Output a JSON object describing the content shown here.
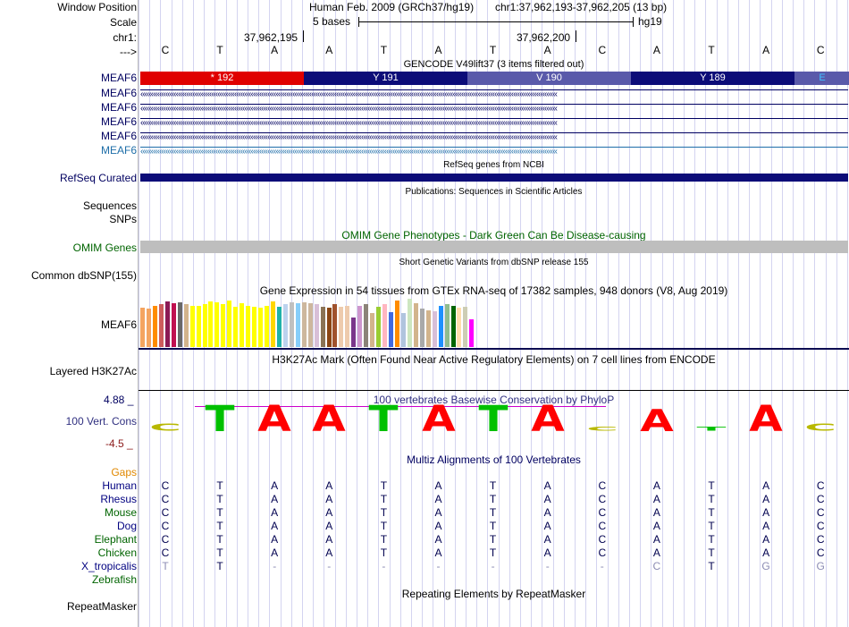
{
  "header": {
    "window_position_label": "Window Position",
    "assembly_text": "Human Feb. 2009 (GRCh37/hg19)",
    "position_text": "chr1:37,962,193-37,962,205 (13 bp)",
    "scale_label": "Scale",
    "scale_text": "5 bases",
    "scale_db": "hg19",
    "chr_label": "chr1:",
    "coord_1": "37,962,195",
    "coord_2": "37,962,200",
    "arrow_label": "--->"
  },
  "bases": [
    "C",
    "T",
    "A",
    "A",
    "T",
    "A",
    "T",
    "A",
    "C",
    "A",
    "T",
    "A",
    "C"
  ],
  "gencode": {
    "title": "GENCODE V49lift37 (3 items filtered out)",
    "segments": [
      {
        "label": "* 192",
        "color": "#e00000"
      },
      {
        "label": "Y 191",
        "color": "#0c0c78"
      },
      {
        "label": "V 190",
        "color": "#5a5aaa"
      },
      {
        "label": "Y 189",
        "color": "#0c0c78"
      },
      {
        "label": "E",
        "color": "#5a5aaa"
      }
    ],
    "tracks": [
      "MEAF6",
      "MEAF6",
      "MEAF6",
      "MEAF6",
      "MEAF6",
      "MEAF6"
    ],
    "track_colors": [
      "#000060",
      "#000060",
      "#000060",
      "#000060",
      "#000060",
      "#1e6ea8"
    ]
  },
  "refseq": {
    "title": "RefSeq genes from NCBI",
    "label": "RefSeq Curated"
  },
  "publications": {
    "title": "Publications: Sequences in Scientific Articles",
    "label": "Sequences"
  },
  "snps": {
    "label": "SNPs"
  },
  "omim": {
    "title": "OMIM Gene Phenotypes - Dark Green Can Be Disease-causing",
    "label": "OMIM Genes"
  },
  "dbsnp": {
    "title": "Short Genetic Variants from dbSNP release 155",
    "label": "Common dbSNP(155)"
  },
  "gtex": {
    "title": "Gene Expression in 54 tissues from GTEx RNA-seq of 17382 samples, 948 donors (V8, Aug 2019)",
    "label": "MEAF6",
    "bars": [
      {
        "v": 0.82,
        "c": "#f4a460"
      },
      {
        "v": 0.8,
        "c": "#f4a460"
      },
      {
        "v": 0.85,
        "c": "#ff8c00"
      },
      {
        "v": 0.88,
        "c": "#cd5c5c"
      },
      {
        "v": 0.95,
        "c": "#8b1a55"
      },
      {
        "v": 0.9,
        "c": "#c01050"
      },
      {
        "v": 0.92,
        "c": "#696969"
      },
      {
        "v": 0.88,
        "c": "#d2b48c"
      },
      {
        "v": 0.86,
        "c": "#ffff00"
      },
      {
        "v": 0.86,
        "c": "#ffff00"
      },
      {
        "v": 0.88,
        "c": "#ffff00"
      },
      {
        "v": 0.95,
        "c": "#ffff00"
      },
      {
        "v": 0.92,
        "c": "#ffff00"
      },
      {
        "v": 0.88,
        "c": "#ffff00"
      },
      {
        "v": 0.96,
        "c": "#ffff00"
      },
      {
        "v": 0.84,
        "c": "#ffff00"
      },
      {
        "v": 0.9,
        "c": "#ffff00"
      },
      {
        "v": 0.86,
        "c": "#ffff00"
      },
      {
        "v": 0.84,
        "c": "#ffff00"
      },
      {
        "v": 0.82,
        "c": "#ffff00"
      },
      {
        "v": 0.86,
        "c": "#ffff00"
      },
      {
        "v": 0.94,
        "c": "#ffd700"
      },
      {
        "v": 0.84,
        "c": "#20b2aa"
      },
      {
        "v": 0.88,
        "c": "#bcd2ee"
      },
      {
        "v": 0.92,
        "c": "#c0c0c0"
      },
      {
        "v": 0.9,
        "c": "#87cefa"
      },
      {
        "v": 0.93,
        "c": "#cdb79e"
      },
      {
        "v": 0.9,
        "c": "#cdb79e"
      },
      {
        "v": 0.88,
        "c": "#d8bfd8"
      },
      {
        "v": 0.84,
        "c": "#8b7355"
      },
      {
        "v": 0.82,
        "c": "#8b4513"
      },
      {
        "v": 0.88,
        "c": "#a0522d"
      },
      {
        "v": 0.84,
        "c": "#eecbad"
      },
      {
        "v": 0.86,
        "c": "#eecbad"
      },
      {
        "v": 0.62,
        "c": "#7a378b"
      },
      {
        "v": 0.86,
        "c": "#cd96cd"
      },
      {
        "v": 0.88,
        "c": "#8b8378"
      },
      {
        "v": 0.7,
        "c": "#d2b48c"
      },
      {
        "v": 0.84,
        "c": "#9acd32"
      },
      {
        "v": 0.88,
        "c": "#ffb6c1"
      },
      {
        "v": 0.72,
        "c": "#4169e1"
      },
      {
        "v": 0.96,
        "c": "#ff8c00"
      },
      {
        "v": 0.7,
        "c": "#b0c4de"
      },
      {
        "v": 1.0,
        "c": "#cde6c0"
      },
      {
        "v": 0.9,
        "c": "#d2b48c"
      },
      {
        "v": 0.8,
        "c": "#a9a9a9"
      },
      {
        "v": 0.76,
        "c": "#d2b48c"
      },
      {
        "v": 0.74,
        "c": "#d8bfd8"
      },
      {
        "v": 0.86,
        "c": "#1e90ff"
      },
      {
        "v": 0.88,
        "c": "#8fbc8f"
      },
      {
        "v": 0.86,
        "c": "#006400"
      },
      {
        "v": 0.82,
        "c": "#ffdead"
      },
      {
        "v": 0.84,
        "c": "#cdcdb4"
      },
      {
        "v": 0.58,
        "c": "#ff00ff"
      }
    ]
  },
  "h3k27ac": {
    "title": "H3K27Ac Mark (Often Found Near Active Regulatory Elements) on 7 cell lines from ENCODE",
    "label": "Layered H3K27Ac"
  },
  "phylop": {
    "title": "100 vertebrates Basewise Conservation by PhyloP",
    "label": "100 Vert. Cons",
    "max_label": "4.88 _",
    "min_label": "-4.5 _",
    "heights": [
      0.25,
      0.95,
      0.95,
      0.95,
      0.95,
      0.95,
      0.95,
      0.95,
      0.15,
      0.8,
      0.15,
      0.95,
      0.25
    ],
    "colors": {
      "A": "#ff0000",
      "T": "#00c000",
      "C": "#b8b800",
      "G": "#e8a000"
    }
  },
  "multiz": {
    "title": "Multiz Alignments of 100 Vertebrates",
    "gaps_label": "Gaps",
    "species": [
      {
        "name": "Human",
        "color": "#000080",
        "seq": [
          "C",
          "T",
          "A",
          "A",
          "T",
          "A",
          "T",
          "A",
          "C",
          "A",
          "T",
          "A",
          "C"
        ]
      },
      {
        "name": "Rhesus",
        "color": "#000080",
        "seq": [
          "C",
          "T",
          "A",
          "A",
          "T",
          "A",
          "T",
          "A",
          "C",
          "A",
          "T",
          "A",
          "C"
        ]
      },
      {
        "name": "Mouse",
        "color": "#006400",
        "seq": [
          "C",
          "T",
          "A",
          "A",
          "T",
          "A",
          "T",
          "A",
          "C",
          "A",
          "T",
          "A",
          "C"
        ]
      },
      {
        "name": "Dog",
        "color": "#000080",
        "seq": [
          "C",
          "T",
          "A",
          "A",
          "T",
          "A",
          "T",
          "A",
          "C",
          "A",
          "T",
          "A",
          "C"
        ]
      },
      {
        "name": "Elephant",
        "color": "#006400",
        "seq": [
          "C",
          "T",
          "A",
          "A",
          "T",
          "A",
          "T",
          "A",
          "C",
          "A",
          "T",
          "A",
          "C"
        ]
      },
      {
        "name": "Chicken",
        "color": "#006400",
        "seq": [
          "C",
          "T",
          "A",
          "A",
          "T",
          "A",
          "T",
          "A",
          "C",
          "A",
          "T",
          "A",
          "C"
        ]
      },
      {
        "name": "X_tropicalis",
        "color": "#000080",
        "seq": [
          "T",
          "T",
          "-",
          "-",
          "-",
          "-",
          "-",
          "-",
          "-",
          "C",
          "T",
          "G",
          "G"
        ]
      },
      {
        "name": "Zebrafish",
        "color": "#006400",
        "seq": []
      }
    ]
  },
  "repeatmasker": {
    "title": "Repeating Elements by RepeatMasker",
    "label": "RepeatMasker"
  }
}
